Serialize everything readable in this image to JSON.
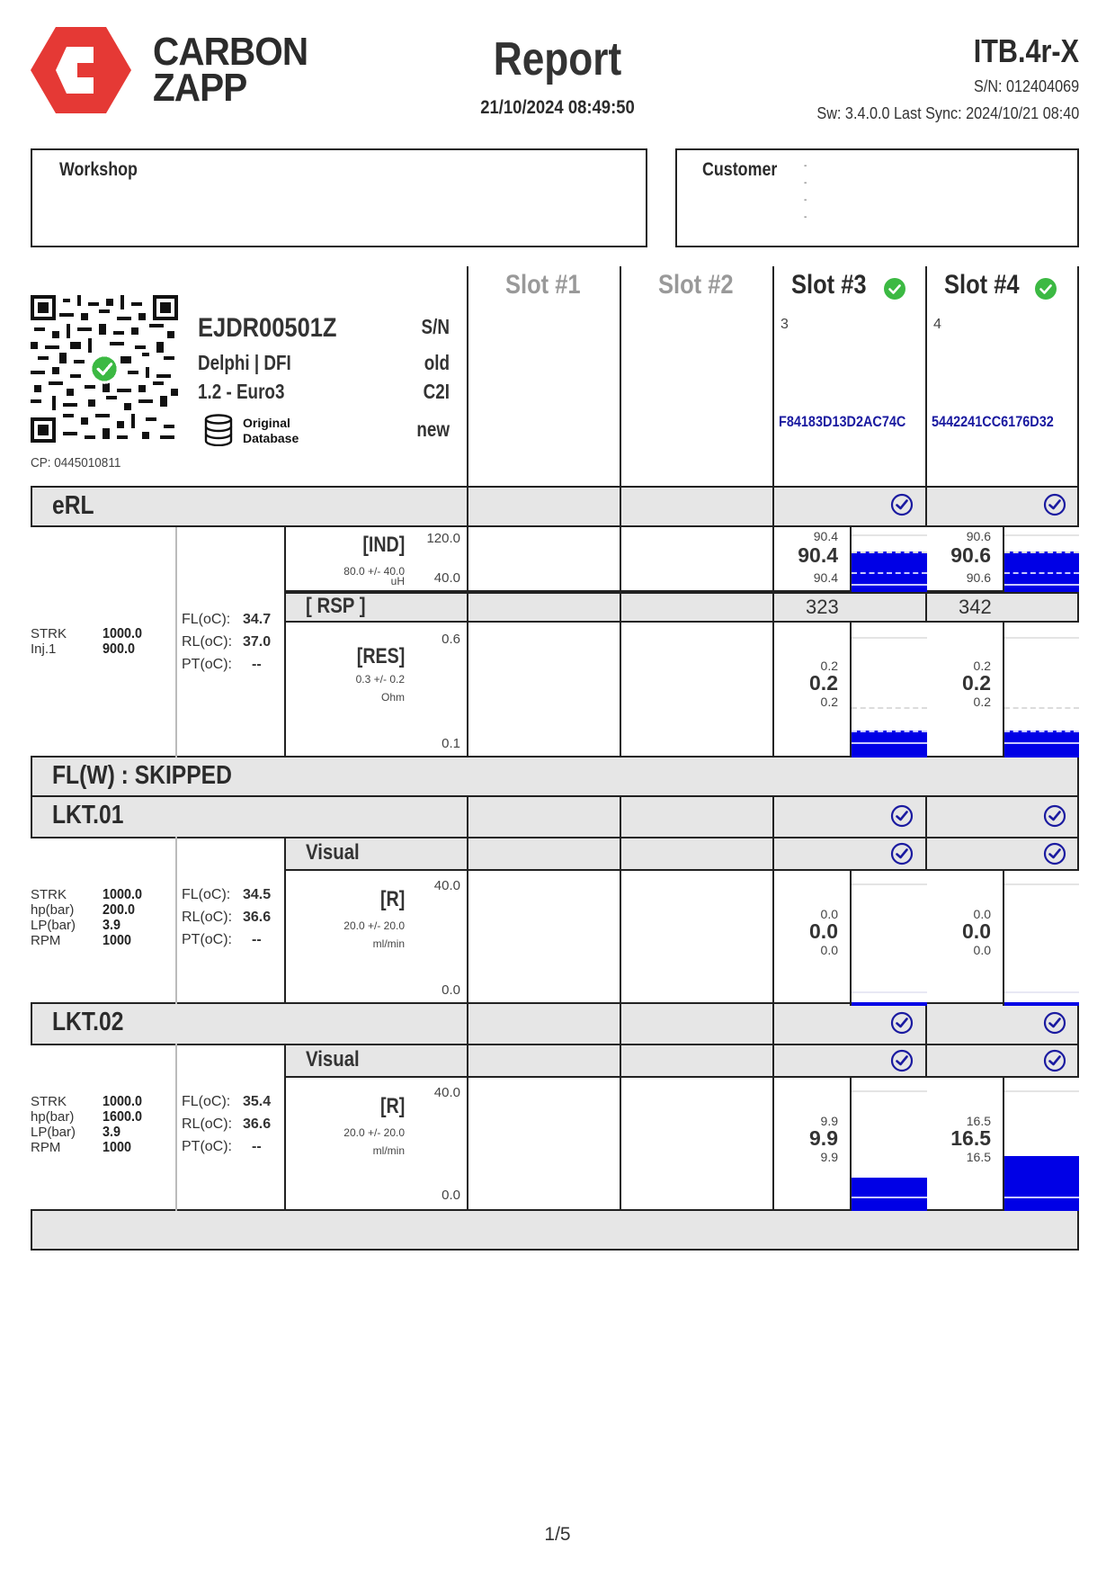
{
  "header": {
    "brand_line1": "CARBON",
    "brand_line2": "ZAPP",
    "brand_color": "#e53935",
    "title": "Report",
    "datetime": "21/10/2024 08:49:50",
    "device_model": "ITB.4r-X",
    "device_sn": "S/N: 012404069",
    "device_sw": "Sw: 3.4.0.0 Last Sync: 2024/10/21 08:40"
  },
  "workshop": {
    "label": "Workshop"
  },
  "customer": {
    "label": "Customer",
    "lines": [
      "-",
      "-",
      "-",
      "-"
    ]
  },
  "injector": {
    "code": "EJDR00501Z",
    "brand": "Delphi | DFI",
    "norm": "1.2 - Euro3",
    "db_label_1": "Original",
    "db_label_2": "Database",
    "cp": "CP: 0445010811",
    "side": [
      "S/N",
      "old",
      "C2I",
      "new"
    ],
    "qr_status": "ok"
  },
  "slots": [
    {
      "title": "Slot #1",
      "active": false,
      "number": "",
      "code": ""
    },
    {
      "title": "Slot #2",
      "active": false,
      "number": "",
      "code": ""
    },
    {
      "title": "Slot #3",
      "active": true,
      "number": "3",
      "code": "F84183D13D2AC74C",
      "status": "ok"
    },
    {
      "title": "Slot #4",
      "active": true,
      "number": "4",
      "code": "5442241CC6176D32",
      "status": "ok"
    }
  ],
  "colors": {
    "bar": "#0000e6",
    "code_text": "#1a1aa0",
    "check_ok": "#3cb943",
    "check_blue": "#1a1aa0",
    "section_bg": "#e6e6e6"
  },
  "erl": {
    "label": "eRL",
    "params": [
      {
        "name": "STRK",
        "value": "1000.0"
      },
      {
        "name": "Inj.1",
        "value": "900.0"
      }
    ],
    "temps": [
      {
        "name": "FL(oC):",
        "value": "34.7"
      },
      {
        "name": "RL(oC):",
        "value": "37.0"
      },
      {
        "name": "PT(oC):",
        "value": "--"
      }
    ],
    "ind": {
      "title": "[IND]",
      "spec": "80.0 +/- 40.0",
      "unit": "uH",
      "axis_max": "120.0",
      "axis_min": "40.0",
      "slot3": {
        "max": "90.4",
        "value": "90.4",
        "min": "90.4",
        "fill_pct": 63
      },
      "slot4": {
        "max": "90.6",
        "value": "90.6",
        "min": "90.6",
        "fill_pct": 63
      }
    },
    "rsp": {
      "title": "[ RSP ]",
      "slot3": "323",
      "slot4": "342"
    },
    "res": {
      "title": "[RES]",
      "spec": "0.3 +/- 0.2",
      "unit": "Ohm",
      "axis_max": "0.6",
      "axis_min": "0.1",
      "slot3": {
        "max": "0.2",
        "value": "0.2",
        "min": "0.2",
        "fill_pct": 20
      },
      "slot4": {
        "max": "0.2",
        "value": "0.2",
        "min": "0.2",
        "fill_pct": 20
      }
    }
  },
  "flw": {
    "label": "FL(W) : SKIPPED"
  },
  "lkt01": {
    "label": "LKT.01",
    "visual_label": "Visual",
    "params": [
      {
        "name": "STRK",
        "value": "1000.0"
      },
      {
        "name": "hp(bar)",
        "value": "200.0"
      },
      {
        "name": "LP(bar)",
        "value": "3.9"
      },
      {
        "name": "RPM",
        "value": "1000"
      }
    ],
    "temps": [
      {
        "name": "FL(oC):",
        "value": "34.5"
      },
      {
        "name": "RL(oC):",
        "value": "36.6"
      },
      {
        "name": "PT(oC):",
        "value": "--"
      }
    ],
    "r": {
      "title": "[R]",
      "spec": "20.0 +/- 20.0",
      "unit": "ml/min",
      "axis_max": "40.0",
      "axis_min": "0.0",
      "slot3": {
        "max": "0.0",
        "value": "0.0",
        "min": "0.0",
        "fill_pct": 0
      },
      "slot4": {
        "max": "0.0",
        "value": "0.0",
        "min": "0.0",
        "fill_pct": 0
      }
    }
  },
  "lkt02": {
    "label": "LKT.02",
    "visual_label": "Visual",
    "params": [
      {
        "name": "STRK",
        "value": "1000.0"
      },
      {
        "name": "hp(bar)",
        "value": "1600.0"
      },
      {
        "name": "LP(bar)",
        "value": "3.9"
      },
      {
        "name": "RPM",
        "value": "1000"
      }
    ],
    "temps": [
      {
        "name": "FL(oC):",
        "value": "35.4"
      },
      {
        "name": "RL(oC):",
        "value": "36.6"
      },
      {
        "name": "PT(oC):",
        "value": "--"
      }
    ],
    "r": {
      "title": "[R]",
      "spec": "20.0 +/- 20.0",
      "unit": "ml/min",
      "axis_max": "40.0",
      "axis_min": "0.0",
      "slot3": {
        "max": "9.9",
        "value": "9.9",
        "min": "9.9",
        "fill_pct": 24.75
      },
      "slot4": {
        "max": "16.5",
        "value": "16.5",
        "min": "16.5",
        "fill_pct": 41.25
      }
    }
  },
  "footer": {
    "page": "1/5"
  }
}
